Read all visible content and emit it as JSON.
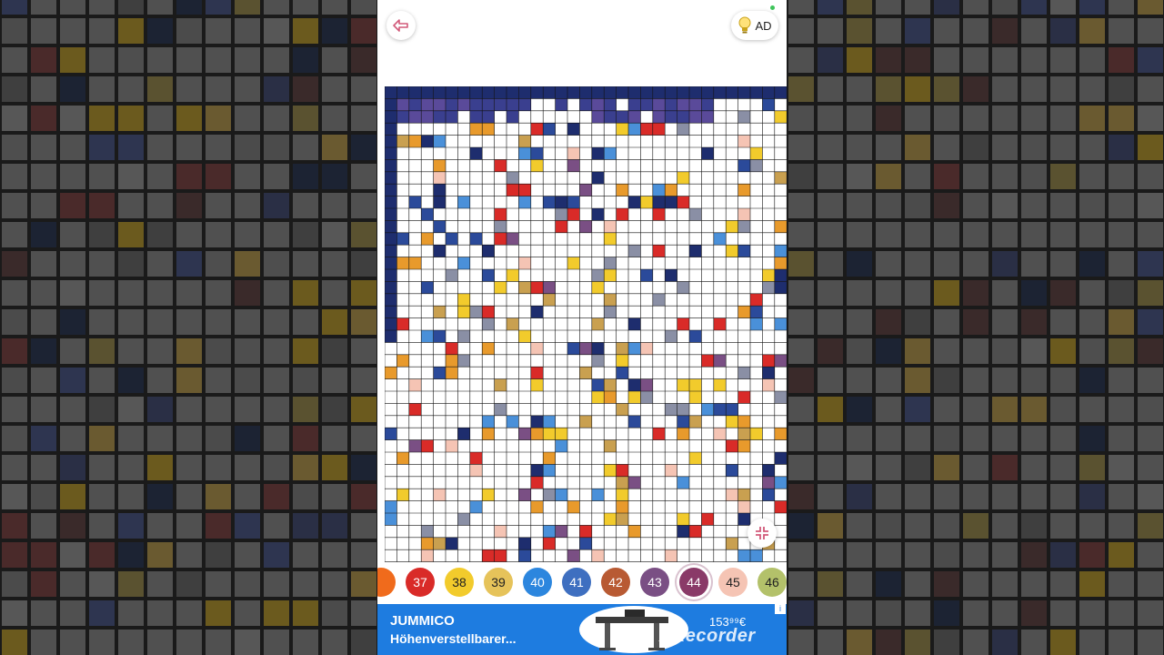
{
  "toolbar": {
    "back_icon": "back-arrow-icon",
    "hint_icon": "lightbulb-icon",
    "hint_label": "AD"
  },
  "canvas": {
    "columns": 33,
    "rows": 39,
    "background": "#ffffff",
    "grid_color": "#111111",
    "border_color": "#1e2d6e",
    "zoom_icon": "collapse-icon"
  },
  "palette": {
    "selected": "44",
    "items": [
      {
        "label": "",
        "color": "#f06b1c"
      },
      {
        "label": "37",
        "color": "#d92b28"
      },
      {
        "label": "38",
        "color": "#f2cb2c"
      },
      {
        "label": "39",
        "color": "#e6c35a"
      },
      {
        "label": "40",
        "color": "#2c86de"
      },
      {
        "label": "41",
        "color": "#3e6fc0"
      },
      {
        "label": "42",
        "color": "#b85a33"
      },
      {
        "label": "43",
        "color": "#7a4f84"
      },
      {
        "label": "44",
        "color": "#8a3a68"
      },
      {
        "label": "45",
        "color": "#f5c4b4"
      },
      {
        "label": "46",
        "color": "#b3c16a"
      }
    ]
  },
  "ad": {
    "brand": "JUMMICO",
    "product": "Höhenverstellbarer...",
    "price": "153⁹⁹€",
    "watermark": "XRecorder",
    "info_icon": "ad-info-icon"
  }
}
